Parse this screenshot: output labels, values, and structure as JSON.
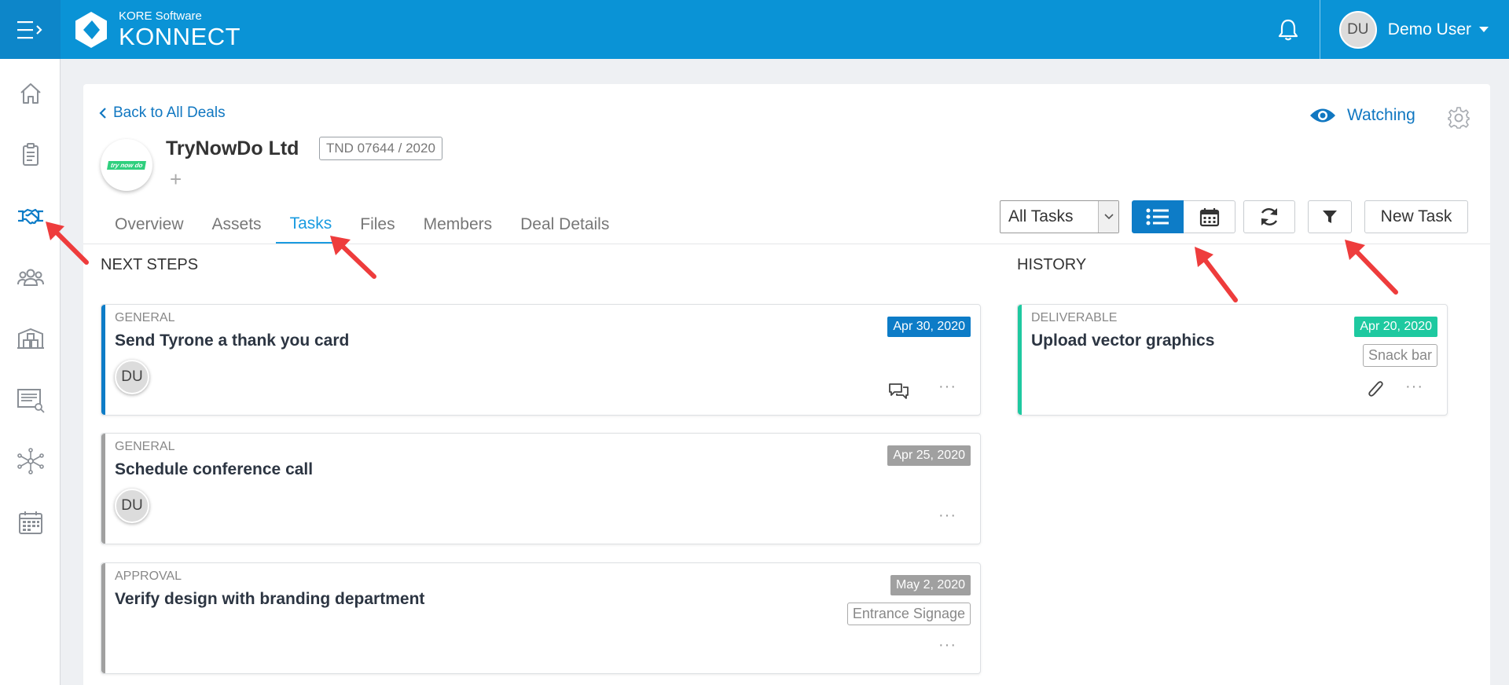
{
  "header": {
    "brand_sub": "KORE Software",
    "brand_main": "KONNECT",
    "user_initials": "DU",
    "user_name": "Demo User"
  },
  "sidebar": {
    "items": [
      "home-icon",
      "clipboard-icon",
      "handshake-icon",
      "people-icon",
      "warehouse-icon",
      "report-search-icon",
      "network-icon",
      "calendar-icon"
    ],
    "active_index": 2
  },
  "deal": {
    "back_label": "Back to All Deals",
    "name": "TryNowDo Ltd",
    "code": "TND 07644 / 2020",
    "logo_text": "try now do",
    "add_label": "+",
    "watch_label": "Watching"
  },
  "tabs": [
    "Overview",
    "Assets",
    "Tasks",
    "Files",
    "Members",
    "Deal Details"
  ],
  "active_tab": "Tasks",
  "toolbar": {
    "filter_select": "All Tasks",
    "new_task_label": "New Task"
  },
  "next_steps": {
    "title": "NEXT STEPS",
    "tasks": [
      {
        "type": "GENERAL",
        "title": "Send Tyrone a thank you card",
        "date": "Apr 30, 2020",
        "assignee": "DU",
        "more": "···"
      },
      {
        "type": "GENERAL",
        "title": "Schedule conference call",
        "date": "Apr 25, 2020",
        "assignee": "DU",
        "more": "···"
      },
      {
        "type": "APPROVAL",
        "title": "Verify design with branding department",
        "date": "May 2, 2020",
        "tag": "Entrance Signage",
        "more": "···"
      }
    ]
  },
  "history": {
    "title": "HISTORY",
    "tasks": [
      {
        "type": "DELIVERABLE",
        "title": "Upload vector graphics",
        "date": "Apr 20, 2020",
        "tag": "Snack bar",
        "more": "···"
      }
    ]
  },
  "colors": {
    "header": "#0a93d6",
    "accent": "#1077c1",
    "blue_date": "#0d7cc7",
    "gray_date": "#a0a0a0",
    "green_date": "#1ec9a0",
    "annotation_arrow": "#ee3c3c"
  }
}
